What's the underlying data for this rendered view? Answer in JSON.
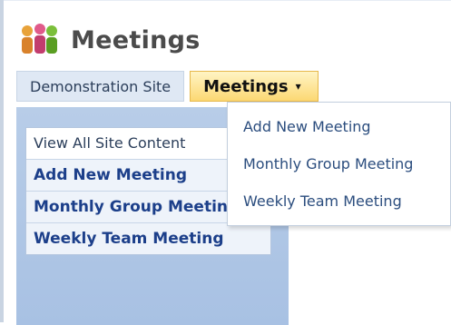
{
  "page": {
    "title": "Meetings"
  },
  "topnav": {
    "items": [
      {
        "label": "Demonstration Site"
      },
      {
        "label": "Meetings",
        "caret": "▾"
      }
    ]
  },
  "dropdown": {
    "items": [
      {
        "label": "Add New Meeting"
      },
      {
        "label": "Monthly Group Meeting"
      },
      {
        "label": "Weekly Team Meeting"
      }
    ]
  },
  "quicklaunch": {
    "items": [
      {
        "label": "View All Site Content"
      },
      {
        "label": "Add New Meeting"
      },
      {
        "label": "Monthly Group Meeting"
      },
      {
        "label": "Weekly Team Meeting"
      }
    ]
  },
  "colors": {
    "accent_active": "#fcd873",
    "nav_bg": "#dfe8f4",
    "panel_bg": "#b8cde8",
    "link": "#1c3f8a"
  },
  "icons": {
    "app": "meeting-people-icon"
  }
}
